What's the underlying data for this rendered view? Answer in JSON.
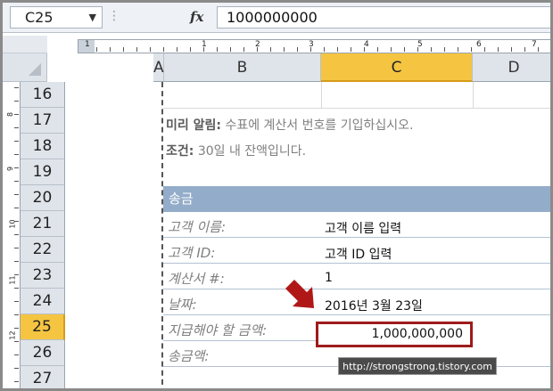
{
  "formula_bar": {
    "name_box": "C25",
    "fx_label": "fx",
    "formula_value": "1000000000"
  },
  "ruler": {
    "numbers": [
      "1",
      "1",
      "2",
      "3",
      "4",
      "5",
      "6",
      "7"
    ]
  },
  "columns": [
    {
      "label": "A",
      "selected": false
    },
    {
      "label": "B",
      "selected": false
    },
    {
      "label": "C",
      "selected": true
    },
    {
      "label": "D",
      "selected": false
    }
  ],
  "vruler_numbers": [
    "8",
    "9",
    "10",
    "11",
    "12"
  ],
  "rows": [
    {
      "num": "16",
      "selected": false
    },
    {
      "num": "17",
      "selected": false
    },
    {
      "num": "18",
      "selected": false
    },
    {
      "num": "19",
      "selected": false
    },
    {
      "num": "20",
      "selected": false
    },
    {
      "num": "21",
      "selected": false
    },
    {
      "num": "22",
      "selected": false
    },
    {
      "num": "23",
      "selected": false
    },
    {
      "num": "24",
      "selected": false
    },
    {
      "num": "25",
      "selected": true
    },
    {
      "num": "26",
      "selected": false
    },
    {
      "num": "27",
      "selected": false
    }
  ],
  "notes": {
    "reminder_label": "미리 알림:",
    "reminder_text": "수표에 계산서 번호를 기입하십시오.",
    "terms_label": "조건:",
    "terms_text": "30일 내 잔액입니다."
  },
  "section": {
    "title": "송금"
  },
  "fields": {
    "customer_name_label": "고객 이름:",
    "customer_name_value": "고객 이름 입력",
    "customer_id_label": "고객 ID:",
    "customer_id_value": "고객 ID 입력",
    "invoice_label": "계산서 #:",
    "invoice_value": "1",
    "date_label": "날짜:",
    "date_value": "2016년 3월 23일",
    "amount_due_label": "지급해야 할 금액:",
    "amount_due_value": "1,000,000,000",
    "remitted_label": "송금액:"
  },
  "watermark": "http://strongstrong.tistory.com",
  "colors": {
    "selected_header": "#f5c542",
    "section_bar": "#93acc9",
    "highlight_border": "#9e1b1b",
    "arrow": "#b01818"
  }
}
